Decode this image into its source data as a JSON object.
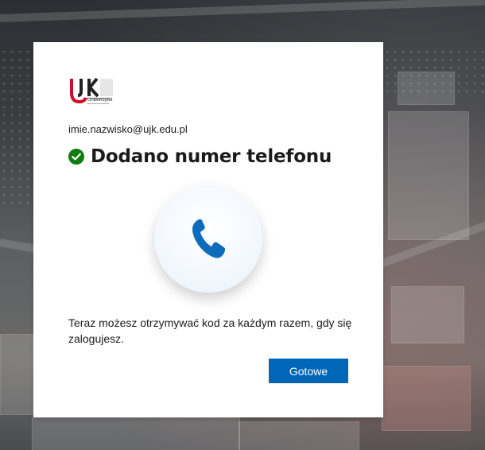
{
  "logo": {
    "text_letters": "UJK",
    "subtitle": "Uniwersytet",
    "brand_colors": {
      "red": "#c8102e",
      "dark": "#222222"
    }
  },
  "account": {
    "email": "imie.nazwisko@ujk.edu.pl"
  },
  "status": {
    "icon": "check-circle-icon",
    "color": "#107c10",
    "title": "Dodano numer telefonu"
  },
  "illustration": {
    "icon": "phone-icon",
    "color": "#0f6cbd"
  },
  "message": "Teraz możesz otrzymywać kod za każdym razem, gdy się zalogujesz.",
  "actions": {
    "done_label": "Gotowe",
    "accent": "#0067b8"
  }
}
